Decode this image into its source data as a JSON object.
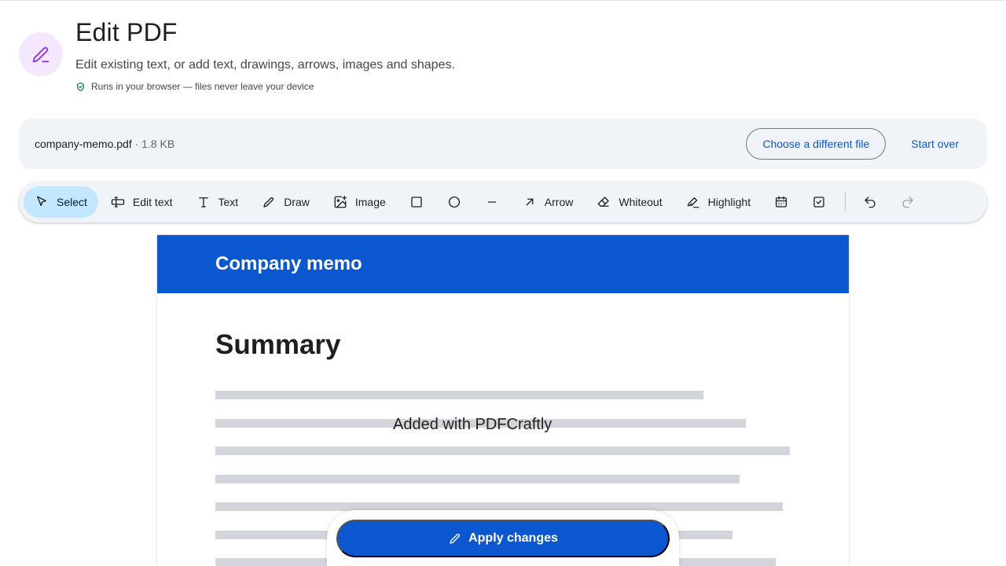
{
  "header": {
    "title": "Edit PDF",
    "subtitle": "Edit existing text, or add text, drawings, arrows, images and shapes.",
    "privacy_note": "Runs in your browser — files never leave your device",
    "icon": "pen-icon",
    "accent_color": "#9334e6"
  },
  "file_bar": {
    "file_name": "company-memo.pdf",
    "file_size": " · 1.8 KB",
    "choose_label": "Choose a different file",
    "start_over_label": "Start over"
  },
  "toolbar": {
    "select": "Select",
    "edit_text": "Edit text",
    "text": "Text",
    "draw": "Draw",
    "image": "Image",
    "arrow": "Arrow",
    "whiteout": "Whiteout",
    "highlight": "Highlight",
    "active_tool": "Select"
  },
  "document": {
    "banner_title": "Company memo",
    "heading": "Summary",
    "annotation": "Added with PDFCraftly",
    "banner_color": "#0b57d0"
  },
  "apply": {
    "label": "Apply changes"
  }
}
